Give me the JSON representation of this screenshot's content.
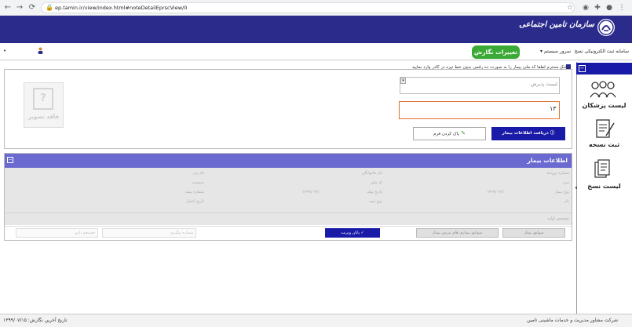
{
  "browser": {
    "url": "ep.tamin.ir/view/index.html#noteDetailEprscView/0"
  },
  "header": {
    "org_name": "سازمان تامین اجتماعی"
  },
  "menu": {
    "system_title": "سامانه ثبت الکترونیکی نسخ",
    "system_services": "سرور سیستم ▾",
    "edit_badge": "تغییرات نگارش",
    "dot": "•"
  },
  "main": {
    "notice": "پزشک محترم لطفا کد ملی بیمار را به صورت ده رقمی بدون خط تیره در کادر وارد نمایید",
    "select_placeholder": "لیست پذیرش",
    "national_id_value": "۱۳",
    "fetch_button": "دریافت اطلاعات بیمار",
    "clear_button": "پاک کردن فرم",
    "noimage_label": "فاقد تصویر"
  },
  "patient_panel": {
    "title": "اطلاعات بیمار",
    "fields_col1": [
      "نام خانوادگی",
      "کد ملی",
      "تاریخ تولد",
      "نوع بیمه"
    ],
    "fields_col2": [
      "نام پدر",
      "جنسیت",
      "شماره بیمه",
      "تاریخ اعتبار"
    ],
    "fields_col3": [
      "شماره پرونده",
      "سن",
      "نوع بیمار",
      "نام"
    ],
    "date_values": [
      "۱۳۹۹/۰۷/۱۰",
      "۱۳۹۹/۰۷/۱۰"
    ],
    "row2_label": "تشخیص اولیه",
    "buttons": {
      "history_btn": "سوابق بیمار",
      "chronic_btn": "سوابق بیماری های مزمن بیمار",
      "end_visit_btn": "پایان ویزیت",
      "note_field": "شماره پیگیری",
      "search_field": "جستجو دارو"
    }
  },
  "sidebar": {
    "items": [
      {
        "label": "لیست پزشکان"
      },
      {
        "label": "ثبت نسخه"
      },
      {
        "label": "لیست نسخ"
      }
    ]
  },
  "footer": {
    "company": "شرکت مشاور مدیریت و خدمات ماشینی تامین",
    "last_edit": "تاریخ آخرین نگارش: ۱۳۹۹/۰۷/۱۵"
  }
}
